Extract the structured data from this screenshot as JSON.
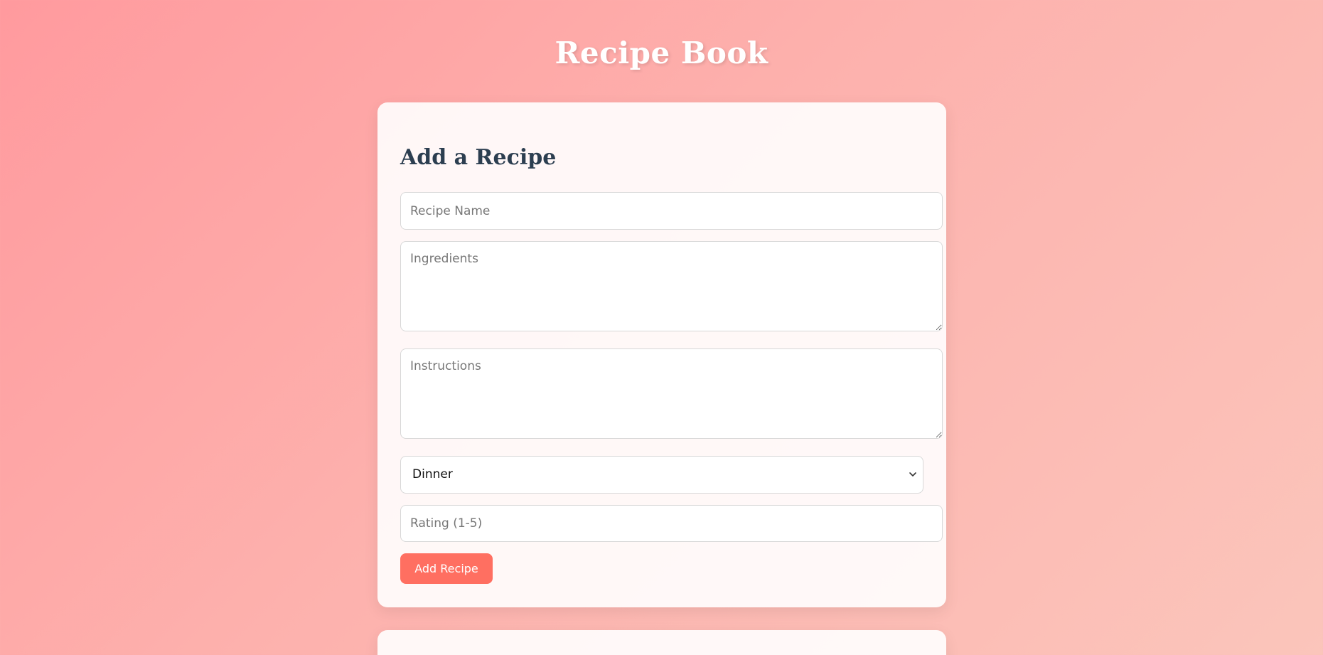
{
  "header": {
    "title": "Recipe Book"
  },
  "form": {
    "title": "Add a Recipe",
    "name_placeholder": "Recipe Name",
    "ingredients_placeholder": "Ingredients",
    "instructions_placeholder": "Instructions",
    "category_selected": "Dinner",
    "rating_placeholder": "Rating (1-5)",
    "submit_label": "Add Recipe"
  },
  "icons": {
    "select_arrow": "chevron-down-icon"
  },
  "colors": {
    "accent": "#ff6f61",
    "heading": "#2c3e50",
    "title": "#ffffff"
  }
}
